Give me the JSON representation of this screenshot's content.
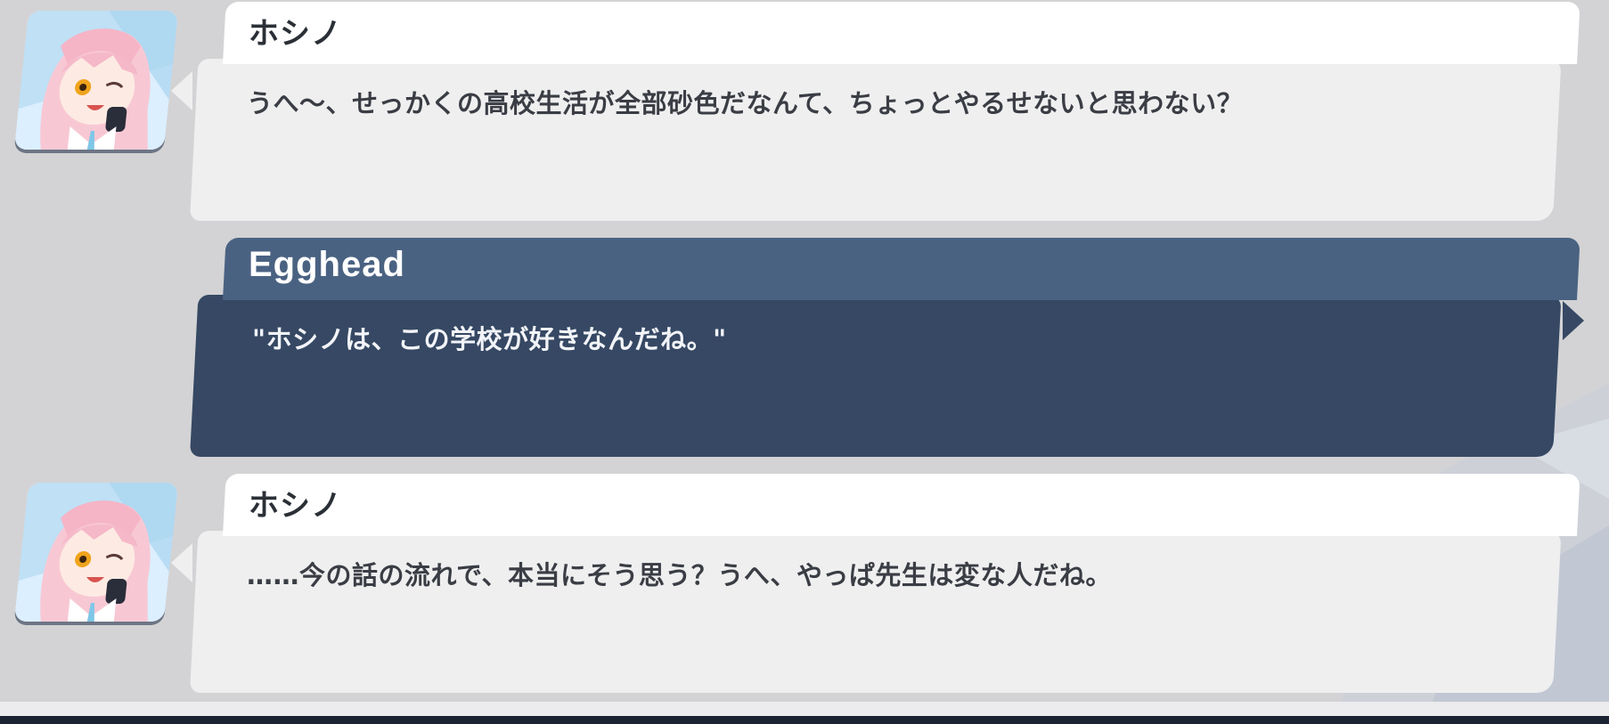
{
  "dialogue": [
    {
      "speaker": "ホシノ",
      "text": "うへ～、せっかくの高校生活が全部砂色だなんて、ちょっとやるせないと思わない？",
      "side": "left",
      "avatar_icon": "hoshino-portrait-icon"
    },
    {
      "speaker": "Egghead",
      "text": "\"ホシノは、この学校が好きなんだね。\"",
      "side": "right",
      "avatar_icon": ""
    },
    {
      "speaker": "ホシノ",
      "text": "……今の話の流れで、本当にそう思う？うへ、やっぱ先生は変な人だね。",
      "side": "left",
      "avatar_icon": "hoshino-portrait-icon"
    }
  ],
  "colors": {
    "background": "#d3d3d5",
    "npc_body": "#efeff0",
    "npc_header": "#ffffff",
    "player_body": "#364863",
    "player_header": "#4a6282",
    "bottom_bar": "#1b2232"
  }
}
